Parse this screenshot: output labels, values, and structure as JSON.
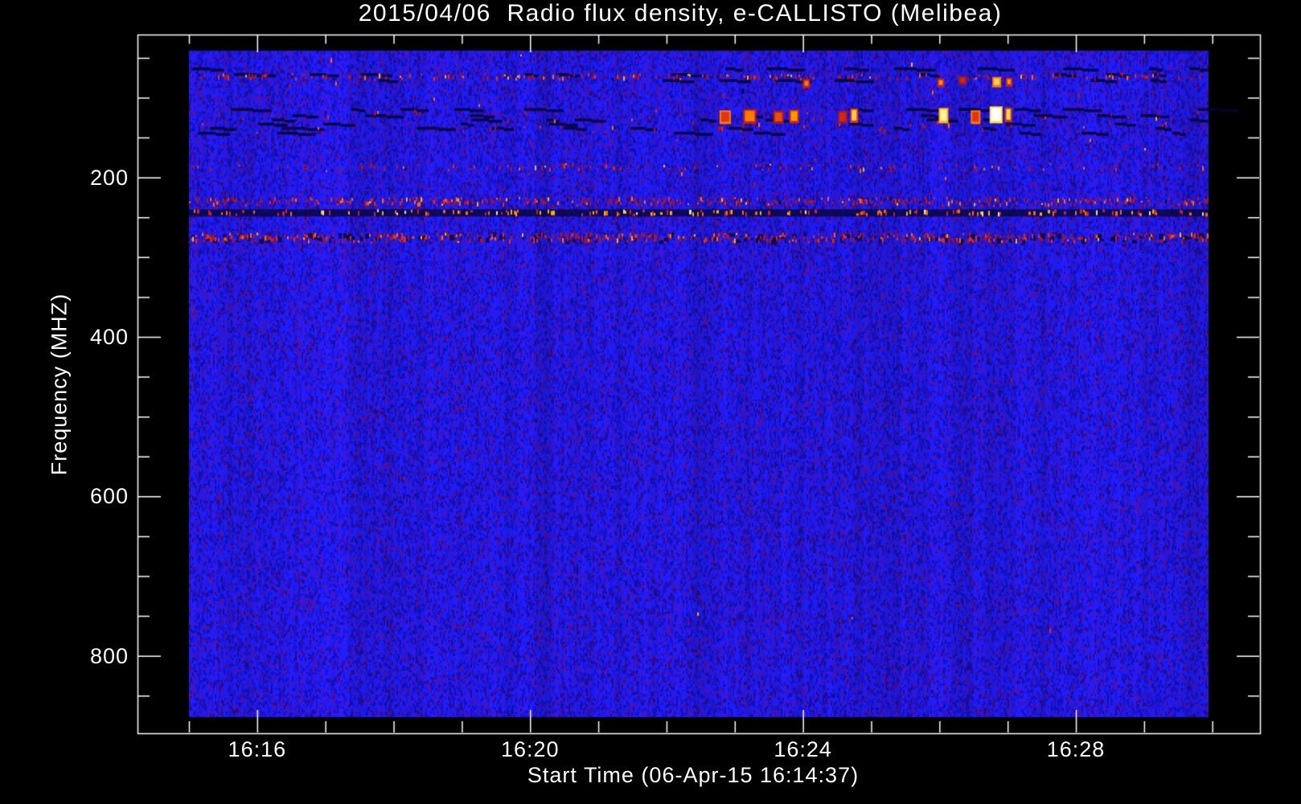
{
  "chart_data": {
    "type": "heatmap",
    "title": "2015/04/06  Radio flux density, e-CALLISTO (Melibea)",
    "xlabel": "Start Time (06-Apr-15 16:14:37)",
    "ylabel": "Frequency (MHZ)",
    "instrument": "e-CALLISTO (Melibea)",
    "date": "2015/04/06",
    "x_axis": {
      "start_time": "16:14:37",
      "major_ticks": [
        {
          "label": "16:16",
          "t_min": 1
        },
        {
          "label": "16:20",
          "t_min": 5
        },
        {
          "label": "16:24",
          "t_min": 9
        },
        {
          "label": "16:28",
          "t_min": 13
        }
      ],
      "minor_tick_step_min": 1,
      "t_range_min": [
        0,
        15
      ]
    },
    "y_axis": {
      "major_ticks": [
        200,
        400,
        600,
        800
      ],
      "minor_tick_step_mhz": 50,
      "minor_range_mhz": [
        50,
        850
      ],
      "f_range_mhz": [
        41,
        877
      ],
      "inverted": true,
      "grid": false
    },
    "legend": null,
    "colors": {
      "background": "#000000",
      "axis": "#ffffff",
      "text": "#fdfdfd",
      "base_palette": [
        {
          "hex": "#1f1cf2",
          "w": 0.44
        },
        {
          "hex": "#1713cf",
          "w": 0.24
        },
        {
          "hex": "#120fa8",
          "w": 0.08
        },
        {
          "hex": "#3c12b5",
          "w": 0.1
        },
        {
          "hex": "#55109d",
          "w": 0.08
        },
        {
          "hex": "#2a0b86",
          "w": 0.06
        }
      ],
      "red_palette": [
        {
          "hex": "#b01717",
          "w": 0.42
        },
        {
          "hex": "#e03010",
          "w": 0.22
        },
        {
          "hex": "#8f1a3c",
          "w": 0.16
        },
        {
          "hex": "#ff6a00",
          "w": 0.12
        },
        {
          "hex": "#ffb300",
          "w": 0.05
        },
        {
          "hex": "#05053a",
          "w": 0.03
        }
      ],
      "dot_palette": [
        {
          "hex": "#d42410",
          "w": 0.4
        },
        {
          "hex": "#ff6a00",
          "w": 0.3
        },
        {
          "hex": "#ffb300",
          "w": 0.2
        },
        {
          "hex": "#ffe680",
          "w": 0.1
        }
      ],
      "dark_dash": "rgba(4,4,46,0.88)",
      "dark_fill": "rgba(6,6,40,0.75)",
      "dark_patch": "rgba(8,7,50,0.8)"
    },
    "features": {
      "bands": [
        {
          "name": "sparse-top-speckle",
          "f_low": 41,
          "f_high": 214,
          "type": "red-speckle",
          "density": 0.05
        },
        {
          "name": "rfi-dash-band-upper",
          "f_low": 62,
          "f_high": 84,
          "type": "dark-dashes",
          "density": 0.55
        },
        {
          "name": "red-speckle-74mhz",
          "f_low": 69,
          "f_high": 79,
          "type": "red-speckle",
          "density": 0.3
        },
        {
          "name": "rfi-dash-band-130mhz",
          "f_low": 113,
          "f_high": 146,
          "type": "dark-dashes",
          "density": 0.6
        },
        {
          "name": "purple-haze-130mhz",
          "f_low": 113,
          "f_high": 146,
          "type": "red-speckle",
          "density": 0.1
        },
        {
          "name": "faint-red-187mhz",
          "f_low": 182,
          "f_high": 193,
          "type": "red-speckle",
          "density": 0.18
        },
        {
          "name": "red-band-230mhz",
          "f_low": 224,
          "f_high": 237,
          "type": "red-speckle",
          "density": 0.5
        },
        {
          "name": "dark-dotted-244mhz",
          "f_low": 240,
          "f_high": 249,
          "type": "dark-dotted",
          "density": 0.24
        },
        {
          "name": "red-band-276mhz",
          "f_low": 269,
          "f_high": 283,
          "type": "red-speckle-dark",
          "density": 0.5
        },
        {
          "name": "sparse-low-speckle",
          "f_low": 300,
          "f_high": 877,
          "type": "red-speckle",
          "density": 0.012
        }
      ],
      "bright_points": [
        {
          "t_min": 7.86,
          "f_mhz": 124,
          "w": 10,
          "h": 12,
          "core": "#e03414",
          "halo": "#ff7a00"
        },
        {
          "t_min": 8.22,
          "f_mhz": 123,
          "w": 12,
          "h": 13,
          "core": "#ff7a00",
          "halo": "#c22010"
        },
        {
          "t_min": 8.64,
          "f_mhz": 124,
          "w": 9,
          "h": 11,
          "core": "#e84d10",
          "halo": "#b01717"
        },
        {
          "t_min": 8.87,
          "f_mhz": 123,
          "w": 8,
          "h": 12,
          "core": "#ff9a00",
          "halo": "#d42410"
        },
        {
          "t_min": 9.58,
          "f_mhz": 124,
          "w": 8,
          "h": 11,
          "core": "#d42410",
          "halo": "#8f1a3c"
        },
        {
          "t_min": 9.75,
          "f_mhz": 122,
          "w": 6,
          "h": 13,
          "core": "#ffd24a",
          "halo": "#e03414"
        },
        {
          "t_min": 11.06,
          "f_mhz": 122,
          "w": 8,
          "h": 14,
          "core": "#fff3a0",
          "halo": "#ffb300"
        },
        {
          "t_min": 11.53,
          "f_mhz": 124,
          "w": 8,
          "h": 12,
          "core": "#e03414",
          "halo": "#ff7a00"
        },
        {
          "t_min": 11.83,
          "f_mhz": 121,
          "w": 12,
          "h": 16,
          "core": "#ffffff",
          "halo": "#ffe04a"
        },
        {
          "t_min": 12.01,
          "f_mhz": 121,
          "w": 5,
          "h": 13,
          "core": "#ffe04a",
          "halo": "#e03414"
        },
        {
          "t_min": 9.05,
          "f_mhz": 82,
          "w": 5,
          "h": 6,
          "core": "#ff7a00",
          "halo": "#c22010"
        },
        {
          "t_min": 11.02,
          "f_mhz": 81,
          "w": 5,
          "h": 6,
          "core": "#ff8c1a",
          "halo": "#c22010"
        },
        {
          "t_min": 11.34,
          "f_mhz": 78,
          "w": 6,
          "h": 6,
          "core": "#d42410",
          "halo": "#8f1a3c"
        },
        {
          "t_min": 11.84,
          "f_mhz": 80,
          "w": 7,
          "h": 8,
          "core": "#ffd24a",
          "halo": "#ff7a00"
        },
        {
          "t_min": 12.02,
          "f_mhz": 80,
          "w": 4,
          "h": 6,
          "core": "#ff9a00",
          "halo": "#d42410"
        }
      ]
    }
  }
}
